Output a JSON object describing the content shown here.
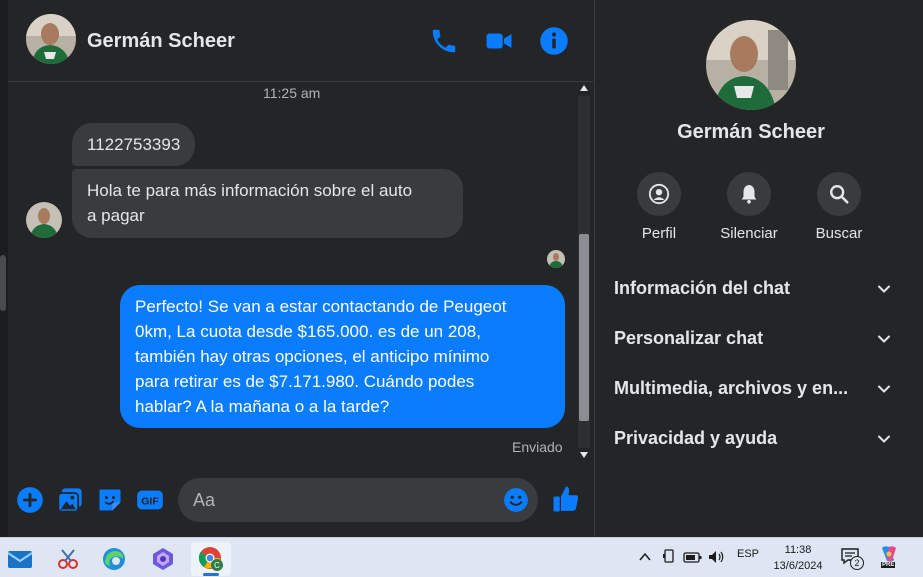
{
  "contact": {
    "name": "Germán Scheer"
  },
  "chat": {
    "time_separator": "11:25 am",
    "messages_in": [
      "1122753393",
      "Hola te para más información sobre el auto",
      "a pagar"
    ],
    "message_out": [
      "Perfecto!  Se van a estar contactando de Peugeot",
      "0km, La cuota desde $165.000. es de un 208,",
      "también hay otras opciones, el anticipo mínimo",
      "para retirar es de $7.171.980. Cuándo podes",
      "hablar? A la mañana o a la tarde?"
    ],
    "status": "Enviado"
  },
  "composer": {
    "placeholder": "Aa"
  },
  "side": {
    "name": "Germán Scheer",
    "actions": [
      "Perfil",
      "Silenciar",
      "Buscar"
    ],
    "sections": [
      "Información del chat",
      "Personalizar chat",
      "Multimedia, archivos y en...",
      "Privacidad y ayuda"
    ]
  },
  "taskbar": {
    "lang": "ESP",
    "time": "11:38",
    "date": "13/6/2024",
    "notif_count": "2",
    "copilot_badge": "PRE"
  },
  "colors": {
    "accent": "#0a7cff",
    "bg": "#242526",
    "bubble_in": "#3a3b3c"
  }
}
